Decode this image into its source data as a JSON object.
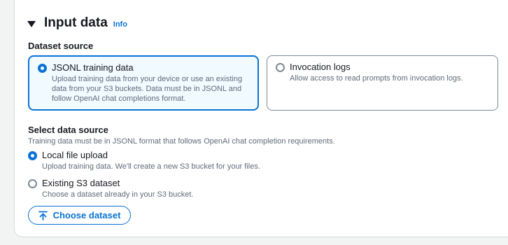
{
  "section": {
    "title": "Input data",
    "info_link": "Info"
  },
  "dataset_source": {
    "label": "Dataset source",
    "options": [
      {
        "label": "JSONL training data",
        "description": "Upload training data from your device or use an existing data from your S3 buckets. Data must be in JSONL and follow OpenAI chat completions format.",
        "selected": true
      },
      {
        "label": "Invocation logs",
        "description": "Allow access to read prompts from invocation logs.",
        "selected": false
      }
    ]
  },
  "select_data_source": {
    "label": "Select data source",
    "description": "Training data must be in JSONL format that follows OpenAI chat completion requirements.",
    "options": [
      {
        "label": "Local file upload",
        "description": "Upload training data. We'll create a new S3 bucket for your files.",
        "selected": true
      },
      {
        "label": "Existing S3 dataset",
        "description": "Choose a dataset already in your S3 bucket.",
        "selected": false
      }
    ]
  },
  "choose_button": {
    "label": "Choose dataset",
    "icon": "upload-icon"
  },
  "colors": {
    "accent": "#0972d3",
    "tile_selected_bg": "#f1faff",
    "text_secondary": "#5f6b7a"
  }
}
